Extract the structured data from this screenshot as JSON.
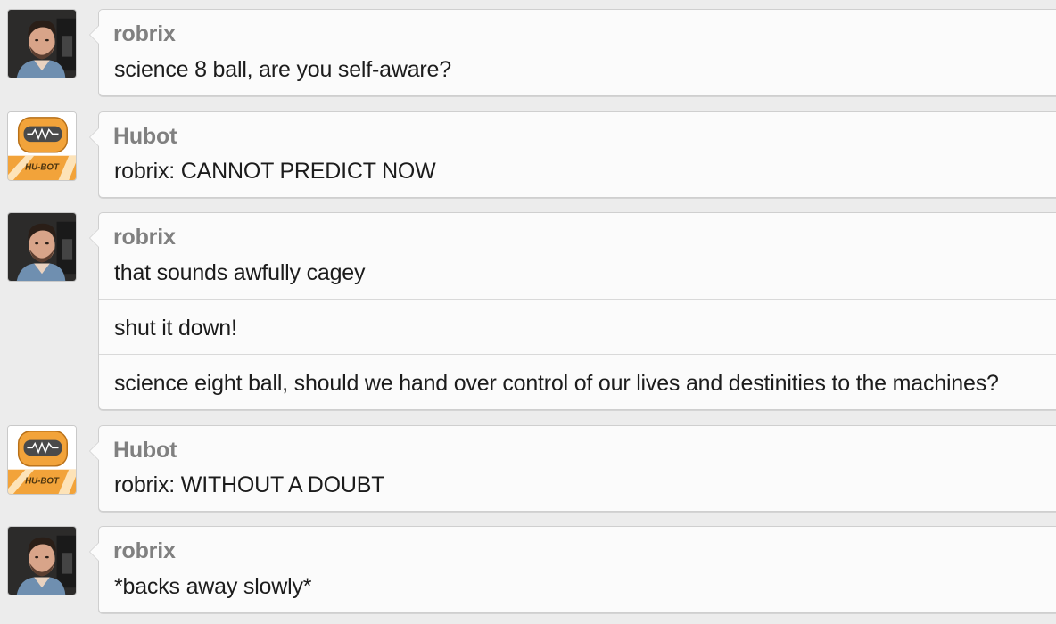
{
  "messages": [
    {
      "author": "robrix",
      "avatar_icon": "robrix-avatar",
      "lines": [
        "science 8 ball, are you self-aware?"
      ]
    },
    {
      "author": "Hubot",
      "avatar_icon": "hubot-avatar",
      "lines": [
        "robrix: CANNOT PREDICT NOW"
      ]
    },
    {
      "author": "robrix",
      "avatar_icon": "robrix-avatar",
      "lines": [
        "that sounds awfully cagey",
        "shut it down!",
        "science eight ball, should we hand over control of our lives and destinities to the machines?"
      ]
    },
    {
      "author": "Hubot",
      "avatar_icon": "hubot-avatar",
      "lines": [
        "robrix: WITHOUT A DOUBT"
      ]
    },
    {
      "author": "robrix",
      "avatar_icon": "robrix-avatar",
      "lines": [
        "*backs away slowly*"
      ]
    }
  ],
  "hubot_badge": "HU-BOT",
  "colors": {
    "hubot_orange": "#f2a33a",
    "background": "#ececec",
    "author": "#808080"
  }
}
